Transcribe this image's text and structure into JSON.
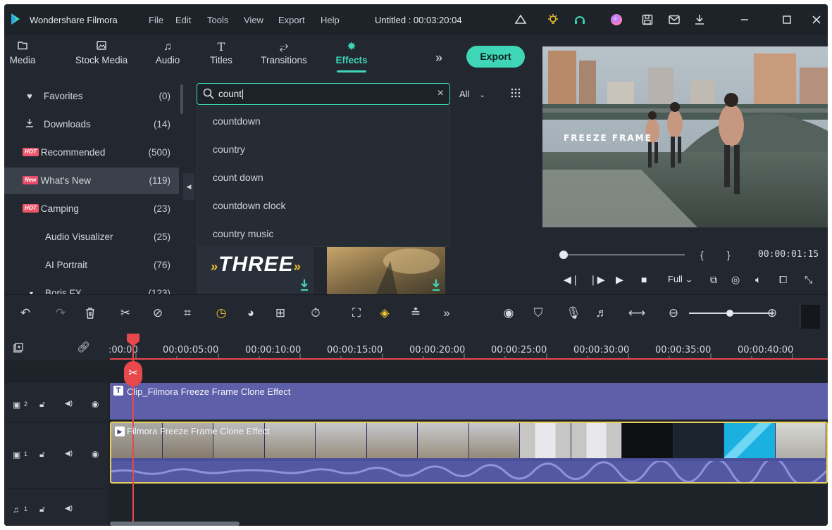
{
  "app": {
    "name": "Wondershare Filmora",
    "menu": [
      "File",
      "Edit",
      "Tools",
      "View",
      "Export",
      "Help"
    ],
    "document": "Untitled : 00:03:20:04",
    "window_icons": [
      "cloud-icon",
      "bulb-icon",
      "support-icon",
      "avatar",
      "save-icon",
      "mail-icon",
      "download-icon",
      "minimize-icon",
      "maximize-icon",
      "close-icon"
    ]
  },
  "media_toolbar": {
    "tabs": [
      {
        "label": "Media",
        "icon": "folder-icon"
      },
      {
        "label": "Stock Media",
        "icon": "stock-media-icon"
      },
      {
        "label": "Audio",
        "icon": "music-note-icon"
      },
      {
        "label": "Titles",
        "icon": "title-t-icon"
      },
      {
        "label": "Transitions",
        "icon": "transitions-icon"
      },
      {
        "label": "Effects",
        "icon": "effects-star-icon",
        "active": true
      }
    ],
    "more": "»",
    "export_label": "Export"
  },
  "sidebar": {
    "items": [
      {
        "label": "Favorites",
        "count": "(0)",
        "icon": "heart-icon"
      },
      {
        "label": "Downloads",
        "count": "(14)",
        "icon": "download-icon"
      },
      {
        "label": "Recommended",
        "count": "(500)",
        "badge": "HOT"
      },
      {
        "label": "What's New",
        "count": "(119)",
        "badge": "New",
        "selected": true
      },
      {
        "label": "Camping",
        "count": "(23)",
        "badge": "HOT"
      },
      {
        "label": "Audio Visualizer",
        "count": "(25)"
      },
      {
        "label": "AI Portrait",
        "count": "(76)"
      },
      {
        "label": "Boris FX",
        "count": "(123)",
        "expander": "▼"
      }
    ]
  },
  "search": {
    "value": "count",
    "filter": "All",
    "suggestions": [
      "countdown",
      "country",
      "count down",
      "countdown clock",
      "country music"
    ]
  },
  "thumbs": {
    "three_text": "THREE"
  },
  "preview": {
    "overlay_text": "FREEZE FRAME",
    "time": "00:00:01:15",
    "brackets": [
      "{",
      "}"
    ],
    "quality": "Full"
  },
  "ruler": {
    "labels": [
      ":00:00",
      "00:00:05:00",
      "00:00:10:00",
      "00:00:15:00",
      "00:00:20:00",
      "00:00:25:00",
      "00:00:30:00",
      "00:00:35:00",
      "00:00:40:00"
    ]
  },
  "tracks": {
    "track2_num": "2",
    "track1_num": "1",
    "audio_num": "1",
    "title_clip": "Clip_Filmora Freeze Frame Clone Effect",
    "video_clip": "Filmora Freeze Frame Clone Effect"
  },
  "colors": {
    "accent": "#3ed6b6",
    "playhead": "#e8474c",
    "title_clip": "#5d5fa8",
    "video_clip": "#4a4f9a",
    "clip_selected_border": "#e9d05b",
    "hot_badge": "#f0566a"
  }
}
